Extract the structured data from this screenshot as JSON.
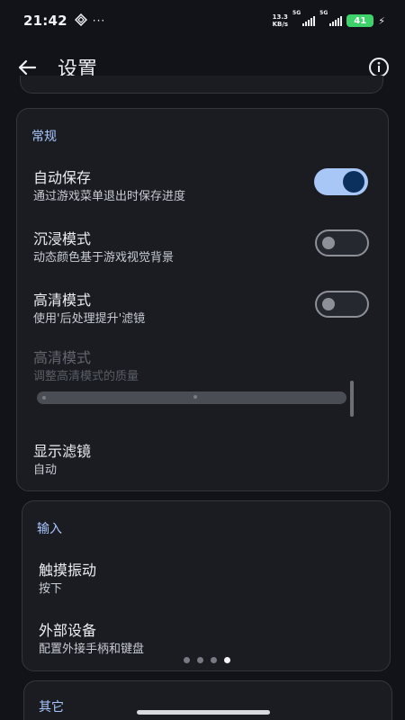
{
  "status_bar": {
    "time": "21:42",
    "more": "···",
    "net_speed_value": "13.3",
    "net_speed_unit": "KB/s",
    "network1": "5G",
    "network2": "5G",
    "battery": "41"
  },
  "app_bar": {
    "title": "设置"
  },
  "sections": {
    "general": {
      "header": "常规",
      "auto_save": {
        "title": "自动保存",
        "subtitle": "通过游戏菜单退出时保存进度",
        "enabled": true
      },
      "immersive": {
        "title": "沉浸模式",
        "subtitle": "动态颜色基于游戏视觉背景",
        "enabled": false
      },
      "hd_mode": {
        "title": "高清模式",
        "subtitle": "使用'后处理提升'滤镜",
        "enabled": false
      },
      "hd_quality": {
        "title": "高清模式",
        "subtitle": "调整高清模式的质量",
        "disabled": true
      },
      "display_filter": {
        "title": "显示滤镜",
        "subtitle": "自动"
      }
    },
    "input": {
      "header": "输入",
      "haptic": {
        "title": "触摸振动",
        "subtitle": "按下"
      },
      "external": {
        "title": "外部设备",
        "subtitle": "配置外接手柄和键盘"
      }
    },
    "other": {
      "header": "其它"
    }
  },
  "pager": {
    "count": 4,
    "active_index": 3
  }
}
